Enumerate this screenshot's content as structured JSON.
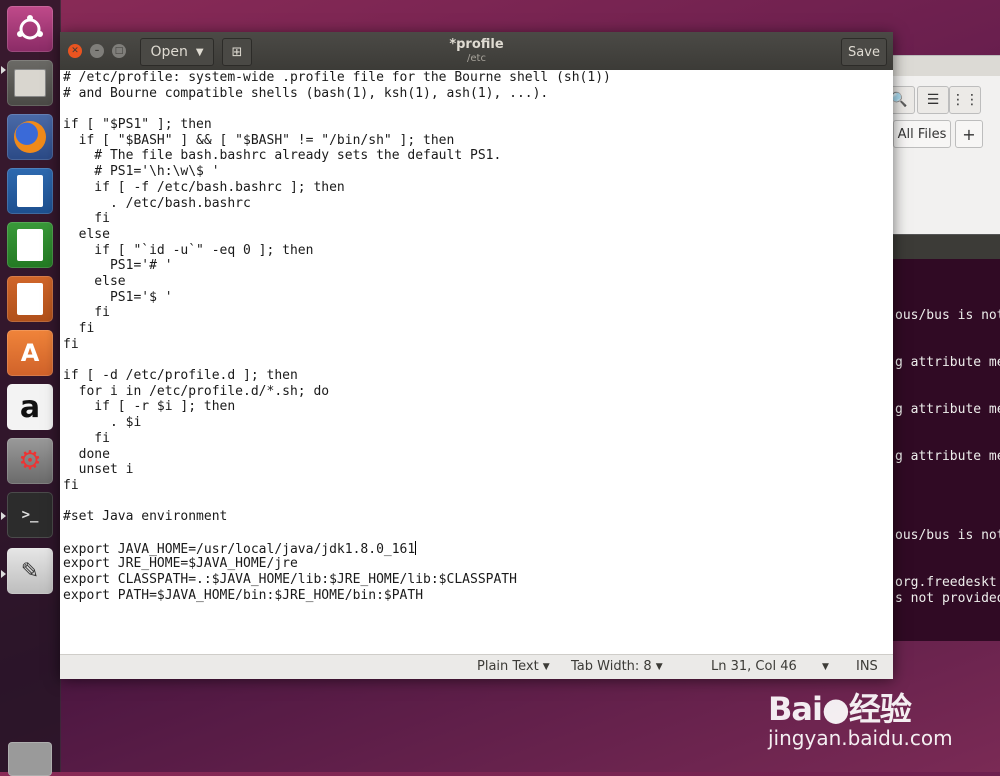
{
  "editor": {
    "title": "*profile",
    "subtitle": "/etc",
    "open_label": "Open",
    "save_label": "Save",
    "lines": [
      "# /etc/profile: system-wide .profile file for the Bourne shell (sh(1))",
      "# and Bourne compatible shells (bash(1), ksh(1), ash(1), ...).",
      "",
      "if [ \"$PS1\" ]; then",
      "  if [ \"$BASH\" ] && [ \"$BASH\" != \"/bin/sh\" ]; then",
      "    # The file bash.bashrc already sets the default PS1.",
      "    # PS1='\\h:\\w\\$ '",
      "    if [ -f /etc/bash.bashrc ]; then",
      "      . /etc/bash.bashrc",
      "    fi",
      "  else",
      "    if [ \"`id -u`\" -eq 0 ]; then",
      "      PS1='# '",
      "    else",
      "      PS1='$ '",
      "    fi",
      "  fi",
      "fi",
      "",
      "if [ -d /etc/profile.d ]; then",
      "  for i in /etc/profile.d/*.sh; do",
      "    if [ -r $i ]; then",
      "      . $i",
      "    fi",
      "  done",
      "  unset i",
      "fi",
      "",
      "#set Java environment",
      "",
      "export JAVA_HOME=/usr/local/java/jdk1.8.0_161",
      "export JRE_HOME=$JAVA_HOME/jre",
      "export CLASSPATH=.:$JAVA_HOME/lib:$JRE_HOME/lib:$CLASSPATH",
      "export PATH=$JAVA_HOME/bin:$JRE_HOME/bin:$PATH"
    ]
  },
  "statusbar": {
    "language": "Plain Text",
    "tab_width": "Tab Width: 8",
    "position": "Ln 31, Col 46",
    "mode": "INS"
  },
  "background_files": {
    "all_files": "All Files",
    "plus": "+"
  },
  "background_terminal": {
    "lines": [
      "ous/bus is not",
      "g attribute me",
      "g attribute me",
      "g attribute me",
      "ous/bus is not",
      "org.freedeskt",
      "s not provided"
    ]
  },
  "watermark": {
    "brand": "Bai●经验",
    "url": "jingyan.baidu.com"
  },
  "launcher": {
    "items": [
      "ubuntu-logo-icon",
      "files-icon",
      "firefox-icon",
      "writer-icon",
      "calc-icon",
      "impress-icon",
      "software-center-icon",
      "amazon-icon",
      "system-settings-icon",
      "terminal-icon",
      "text-editor-icon",
      "trash-icon"
    ]
  },
  "colors": {
    "desktop": "#6a1f4e",
    "titlebar": "#3c3b37",
    "close": "#e95420",
    "terminal_bg": "#300a24"
  }
}
